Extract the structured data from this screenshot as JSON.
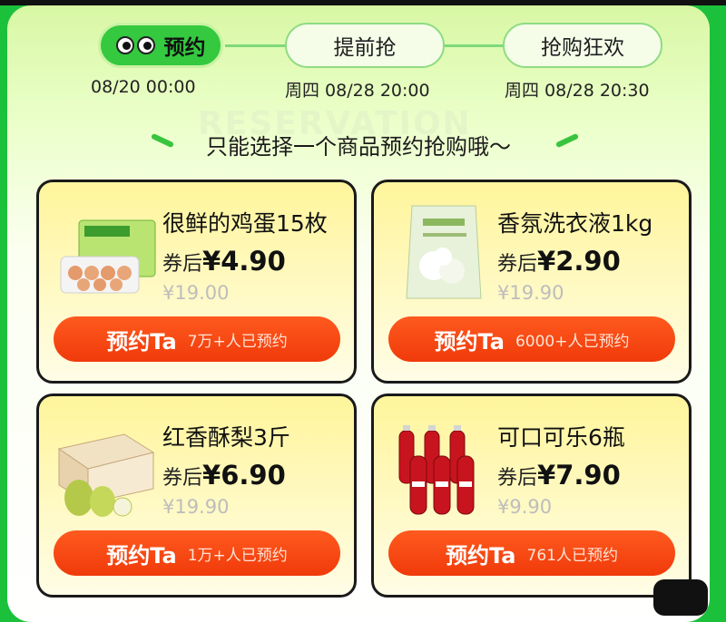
{
  "steps": [
    {
      "label": "预约",
      "time": "08/20 00:00",
      "active": true
    },
    {
      "label": "提前抢",
      "time": "周四 08/28 20:00",
      "active": false
    },
    {
      "label": "抢购狂欢",
      "time": "周四 08/28 20:30",
      "active": false
    }
  ],
  "banner": {
    "watermark": "RESERVATION",
    "tagline": "只能选择一个商品预约抢购哦～"
  },
  "products": [
    {
      "name": "很鲜的鸡蛋15枚",
      "price_label": "券后",
      "price": "¥4.90",
      "original": "¥19.00",
      "button": "预约Ta",
      "count": "7万+人已预约",
      "icon": "egg-box-icon"
    },
    {
      "name": "香氛洗衣液1kg",
      "price_label": "券后",
      "price": "¥2.90",
      "original": "¥19.90",
      "button": "预约Ta",
      "count": "6000+人已预约",
      "icon": "detergent-pouch-icon"
    },
    {
      "name": "红香酥梨3斤",
      "price_label": "券后",
      "price": "¥6.90",
      "original": "¥19.90",
      "button": "预约Ta",
      "count": "1万+人已预约",
      "icon": "pear-box-icon"
    },
    {
      "name": "可口可乐6瓶",
      "price_label": "券后",
      "price": "¥7.90",
      "original": "¥9.90",
      "button": "预约Ta",
      "count": "761人已预约",
      "icon": "cola-bottles-icon"
    }
  ],
  "colors": {
    "accent_green": "#34c93f",
    "button_orange": "#f24b14",
    "card_yellow": "#fff59c"
  }
}
